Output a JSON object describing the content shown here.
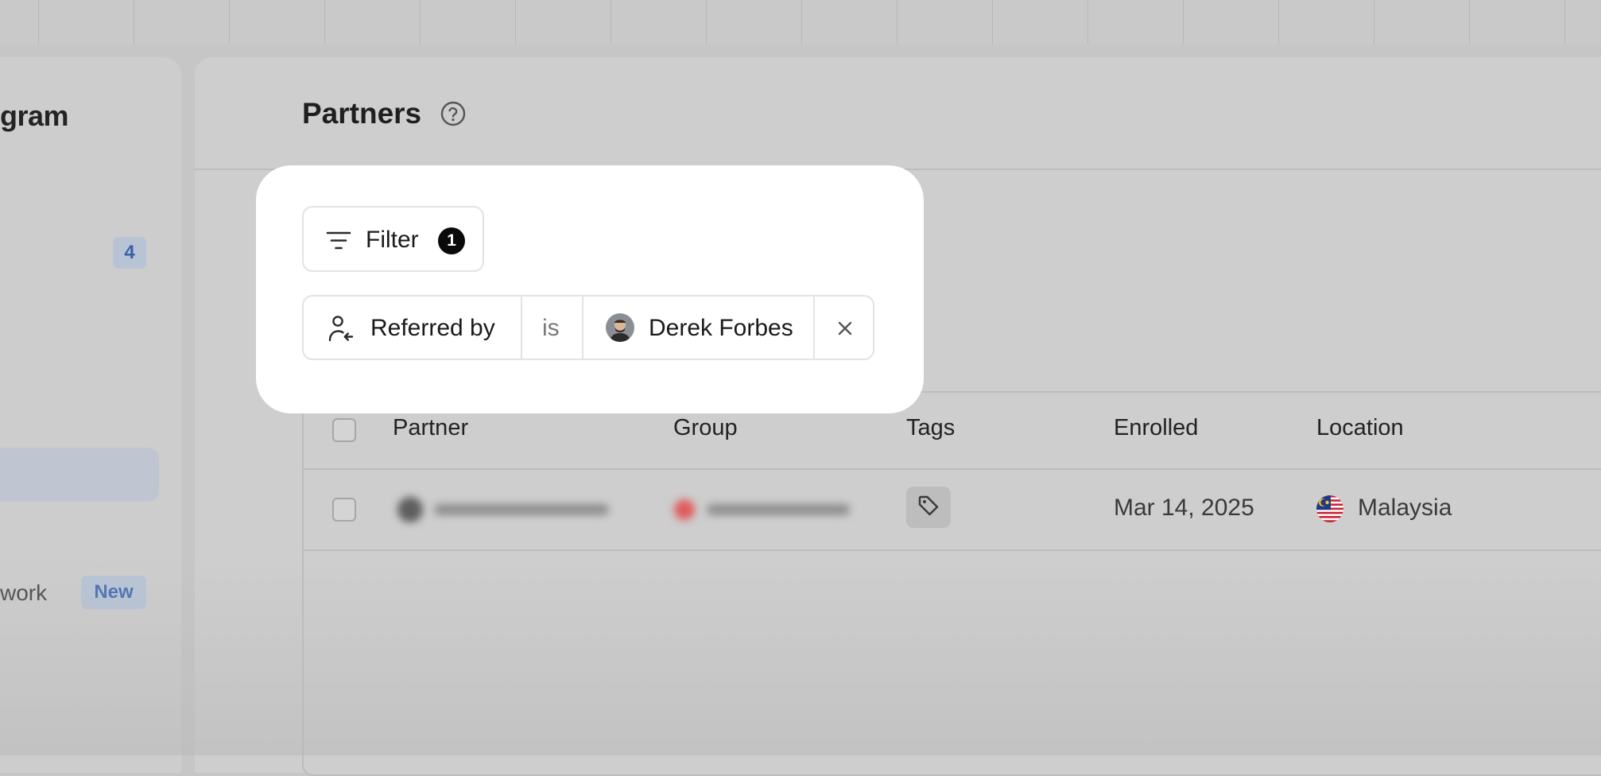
{
  "sidebar": {
    "title_fragment": "gram",
    "badge_count": "4",
    "item_fragment": "work",
    "new_badge": "New"
  },
  "page": {
    "title": "Partners"
  },
  "filter_button": {
    "label": "Filter",
    "count": "1"
  },
  "active_filter": {
    "field": "Referred by",
    "operator": "is",
    "value": "Derek Forbes"
  },
  "table": {
    "headers": [
      "Partner",
      "Group",
      "Tags",
      "Enrolled",
      "Location"
    ],
    "rows": [
      {
        "enrolled": "Mar 14, 2025",
        "location": "Malaysia"
      }
    ]
  },
  "icons": {
    "help": "help-circle-icon",
    "filter": "filter-lines-icon",
    "referred": "user-referral-icon",
    "remove": "close-icon",
    "tag": "tag-icon",
    "flag": "malaysia-flag-icon"
  },
  "colors": {
    "overlay": "#c6c6c6",
    "spotlight": "#ffffff",
    "badge_bg": "#b8c4d6",
    "badge_text": "#3a5fa6",
    "filter_count_bg": "#0a0a0a"
  }
}
